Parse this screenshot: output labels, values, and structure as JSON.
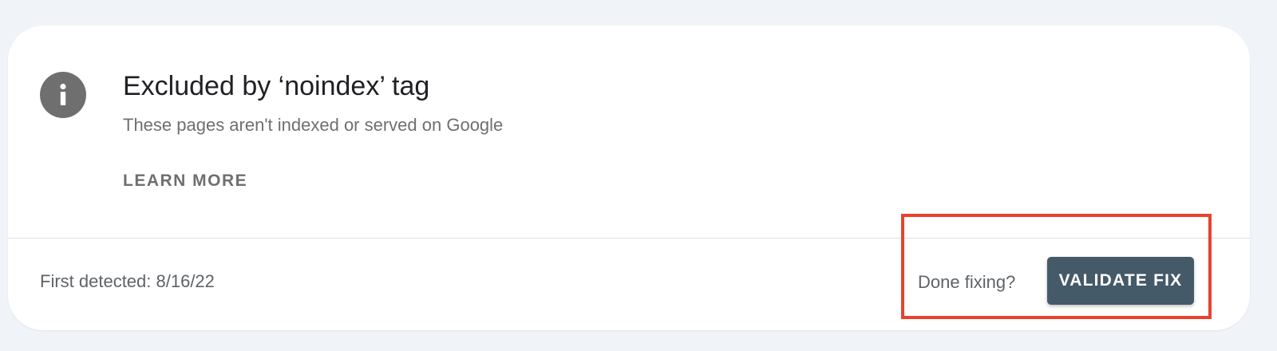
{
  "issue": {
    "icon": "info-icon",
    "title": "Excluded by ‘noindex’ tag",
    "subtitle": "These pages aren't indexed or served on Google",
    "learn_more_label": "LEARN MORE"
  },
  "footer": {
    "first_detected": "First detected: 8/16/22",
    "done_fixing_prompt": "Done fixing?",
    "validate_label": "VALIDATE FIX"
  },
  "colors": {
    "page_background": "#f0f4f9",
    "card_background": "#ffffff",
    "icon_background": "#6f6f6f",
    "button_background": "#455a68",
    "highlight_box": "#e8432d"
  }
}
